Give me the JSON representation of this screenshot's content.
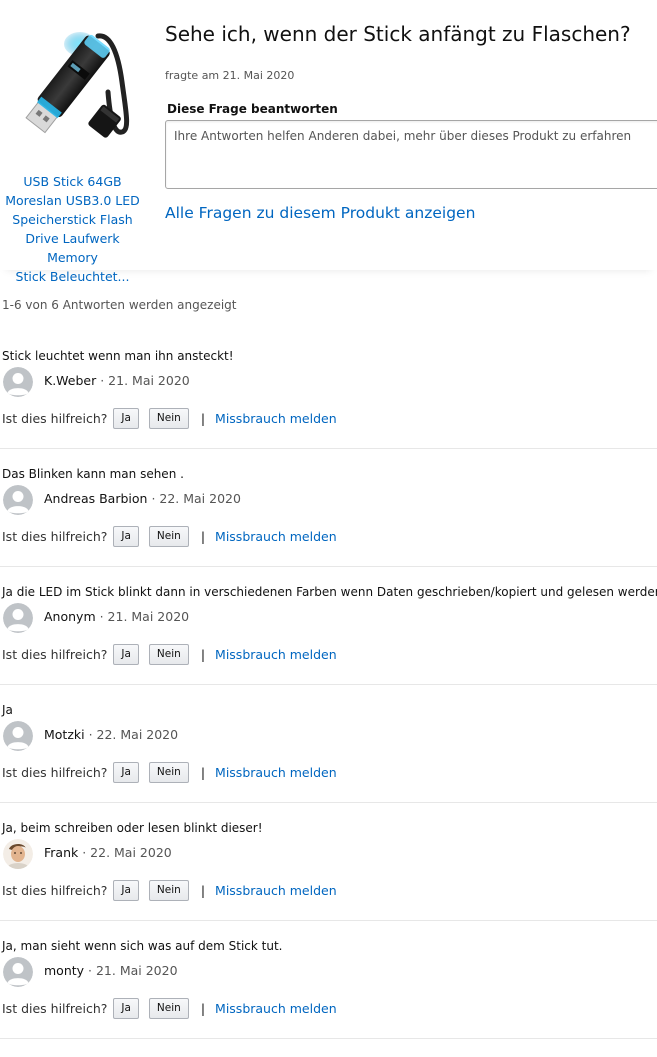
{
  "product": {
    "title": "USB Stick 64GB\nMoreslan USB3.0 LED\nSpeicherstick Flash\nDrive Laufwerk Memory\nStick Beleuchtet...",
    "image_icon": "usb-stick-image"
  },
  "question": {
    "text": "Sehe ich, wenn der Stick anfängt zu Flaschen?",
    "asked": "fragte am 21. Mai 2020"
  },
  "answer_form": {
    "label": "Diese Frage beantworten",
    "placeholder": "Ihre Antworten helfen Anderen dabei, mehr über dieses Produkt zu erfahren"
  },
  "all_questions_link": "Alle Fragen zu diesem Produkt anzeigen",
  "answer_count": "1-6 von 6 Antworten werden angezeigt",
  "labels": {
    "helpful": "Ist dies hilfreich?",
    "yes": "Ja",
    "no": "Nein",
    "separator": "|",
    "report": "Missbrauch melden"
  },
  "answers": [
    {
      "text": "Stick leuchtet wenn man ihn ansteckt!",
      "author": "K.Weber",
      "date": " · 21. Mai 2020",
      "avatar": "default"
    },
    {
      "text": "Das Blinken kann man sehen .",
      "author": "Andreas Barbion",
      "date": " · 22. Mai 2020",
      "avatar": "default"
    },
    {
      "text": "Ja die LED im Stick blinkt dann in verschiedenen Farben wenn Daten geschrieben/kopiert und gelesen werden.",
      "author": "Anonym",
      "date": " · 21. Mai 2020",
      "avatar": "default"
    },
    {
      "text": "Ja",
      "author": "Motzki",
      "date": " · 22. Mai 2020",
      "avatar": "default"
    },
    {
      "text": "Ja, beim schreiben oder lesen blinkt dieser!",
      "author": "Frank",
      "date": " · 22. Mai 2020",
      "avatar": "photo"
    },
    {
      "text": "Ja, man sieht wenn sich was auf dem Stick tut.",
      "author": "monty",
      "date": " · 21. Mai 2020",
      "avatar": "default"
    }
  ],
  "colors": {
    "link": "#0066c0",
    "text": "#111111",
    "muted": "#555555",
    "avatar_bg": "#bfc3c7",
    "divider": "#e7e7e7"
  }
}
